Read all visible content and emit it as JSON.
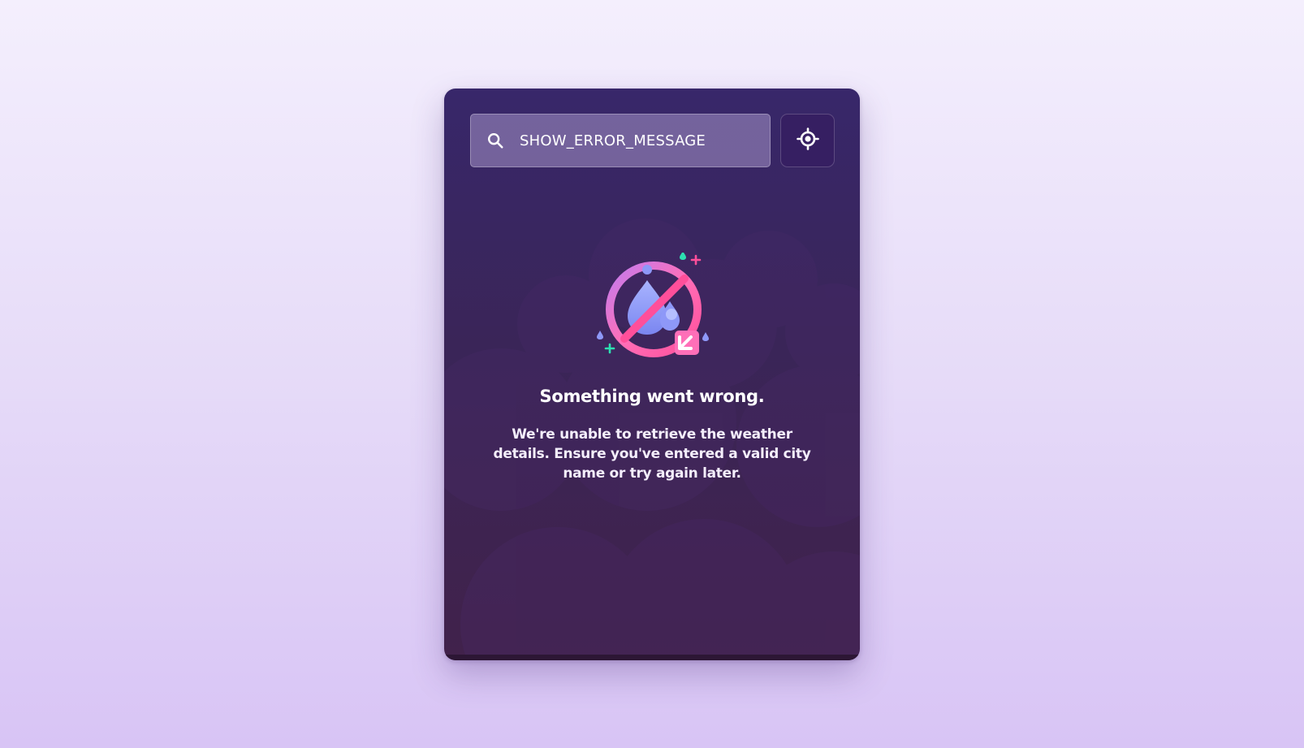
{
  "search": {
    "value": "SHOW_ERROR_MESSAGE",
    "icon": "search-icon"
  },
  "locate_button": {
    "icon": "location-crosshair-icon"
  },
  "error": {
    "illustration_icon": "no-water-drop-icon",
    "title": "Something went wrong.",
    "message": "We're unable to retrieve the weather details. Ensure you've entered a valid city name or try again later."
  },
  "colors": {
    "page_background_top": "#f4effd",
    "page_background_bottom": "#d8c4f5",
    "card_top": "#38276a",
    "card_bottom": "#41224b",
    "accent_pink": "#ff4f9a",
    "accent_drop": "#9aa6ff",
    "accent_teal": "#2de0b0"
  }
}
